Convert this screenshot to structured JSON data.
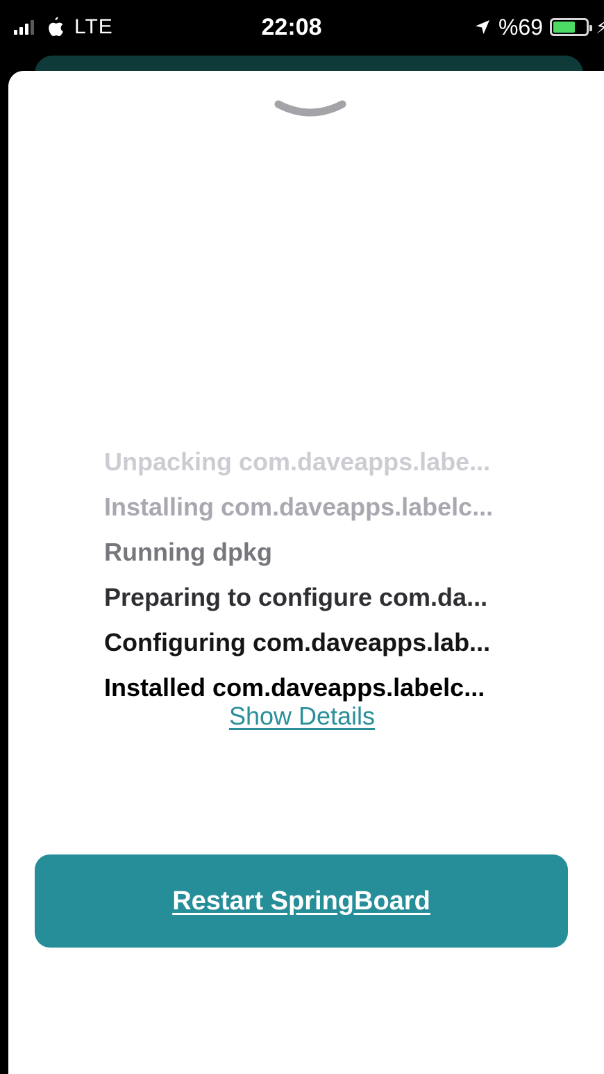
{
  "status_bar": {
    "carrier_logo": "apple-logo-icon",
    "network_type": "LTE",
    "time": "22:08",
    "location_icon": "location-arrow-icon",
    "battery_percent_text": "%69",
    "battery_level": 0.69,
    "battery_color": "#4cd964",
    "charging_icon": "bolt-icon"
  },
  "sheet": {
    "grabber_icon": "chevron-down-icon",
    "log_lines": [
      "Unpacking com.daveapps.labe...",
      "Installing com.daveapps.labelc...",
      "Running dpkg",
      "Preparing to configure com.da...",
      "Configuring com.daveapps.lab...",
      "Installed com.daveapps.labelc..."
    ],
    "details_link": "Show Details",
    "restart_button": "Restart SpringBoard"
  },
  "colors": {
    "accent": "#268e99",
    "link": "#2a8f99",
    "header_behind": "#0e3b3a"
  }
}
